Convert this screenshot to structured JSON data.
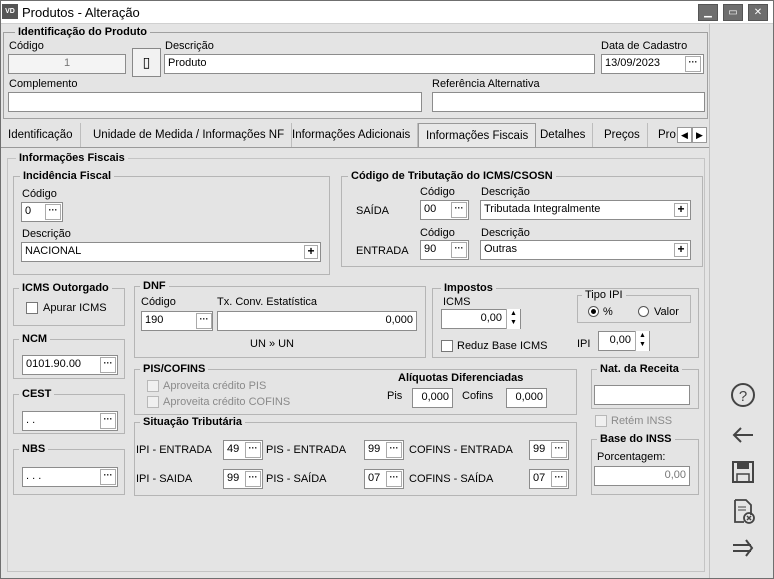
{
  "window": {
    "icon": "VD",
    "title": "Produtos - Alteração",
    "minimize": "▁",
    "maximize": "▭",
    "close": "✕"
  },
  "ident": {
    "title": "Identificação do Produto",
    "codigo_label": "Código",
    "codigo": "1",
    "descricao_label": "Descrição",
    "descricao": "Produto",
    "data_label": "Data de Cadastro",
    "data": "13/09/2023",
    "complemento_label": "Complemento",
    "complemento": "",
    "ref_label": "Referência Alternativa",
    "ref": ""
  },
  "tabs": [
    {
      "label": "Identificação"
    },
    {
      "label": "Unidade de Medida / Informações NF"
    },
    {
      "label": "Informações Adicionais"
    },
    {
      "label": "Informações Fiscais"
    },
    {
      "label": "Detalhes"
    },
    {
      "label": "Preços"
    },
    {
      "label": "Pro"
    }
  ],
  "fiscal": {
    "title": "Informações Fiscais",
    "incidencia": {
      "title": "Incidência Fiscal",
      "codigo_label": "Código",
      "codigo": "0",
      "descricao_label": "Descrição",
      "descricao": "NACIONAL"
    },
    "icms_trib": {
      "title": "Código de Tributação do ICMS/CSOSN",
      "saida_label": "SAÍDA",
      "entrada_label": "ENTRADA",
      "codigo_label": "Código",
      "descricao_label": "Descrição",
      "saida_codigo": "00",
      "saida_desc": "Tributada Integralmente",
      "entrada_codigo": "90",
      "entrada_desc": "Outras"
    },
    "icms_outorgado": {
      "title": "ICMS Outorgado",
      "apurar": "Apurar ICMS"
    },
    "ncm": {
      "title": "NCM",
      "value": "0101.90.00"
    },
    "cest": {
      "title": "CEST",
      "value": " .  ."
    },
    "nbs": {
      "title": "NBS",
      "value": " .  .  ."
    },
    "dnf": {
      "title": "DNF",
      "codigo_label": "Código",
      "codigo": "190",
      "tx_label": "Tx. Conv. Estatística",
      "tx": "0,000",
      "un": "UN » UN"
    },
    "impostos": {
      "title": "Impostos",
      "icms_label": "ICMS",
      "icms": "0,00",
      "reduz": "Reduz Base ICMS",
      "tipo_ipi": "Tipo IPI",
      "pct": "%",
      "valor": "Valor",
      "ipi_label": "IPI",
      "ipi": "0,00"
    },
    "pis_cofins": {
      "title": "PIS/COFINS",
      "aprov_pis": "Aproveita crédito PIS",
      "aprov_cofins": "Aproveita crédito COFINS",
      "aliq_title": "Alíquotas Diferenciadas",
      "pis_label": "Pis",
      "pis": "0,000",
      "cofins_label": "Cofins",
      "cofins": "0,000"
    },
    "sit_trib": {
      "title": "Situação Tributária",
      "ipi_entrada": "IPI - ENTRADA",
      "ipi_entrada_v": "49",
      "pis_entrada": "PIS - ENTRADA",
      "pis_entrada_v": "99",
      "cofins_entrada": "COFINS - ENTRADA",
      "cofins_entrada_v": "99",
      "ipi_saida": "IPI - SAIDA",
      "ipi_saida_v": "99",
      "pis_saida": "PIS - SAÍDA",
      "pis_saida_v": "07",
      "cofins_saida": "COFINS - SAÍDA",
      "cofins_saida_v": "07"
    },
    "nat_receita": {
      "title": "Nat. da Receita",
      "value": ""
    },
    "retem_inss": "Retém INSS",
    "base_inss": {
      "title": "Base do INSS",
      "label": "Porcentagem:",
      "value": "0,00"
    }
  },
  "buttons": {
    "dots": "···",
    "plus": "+"
  }
}
